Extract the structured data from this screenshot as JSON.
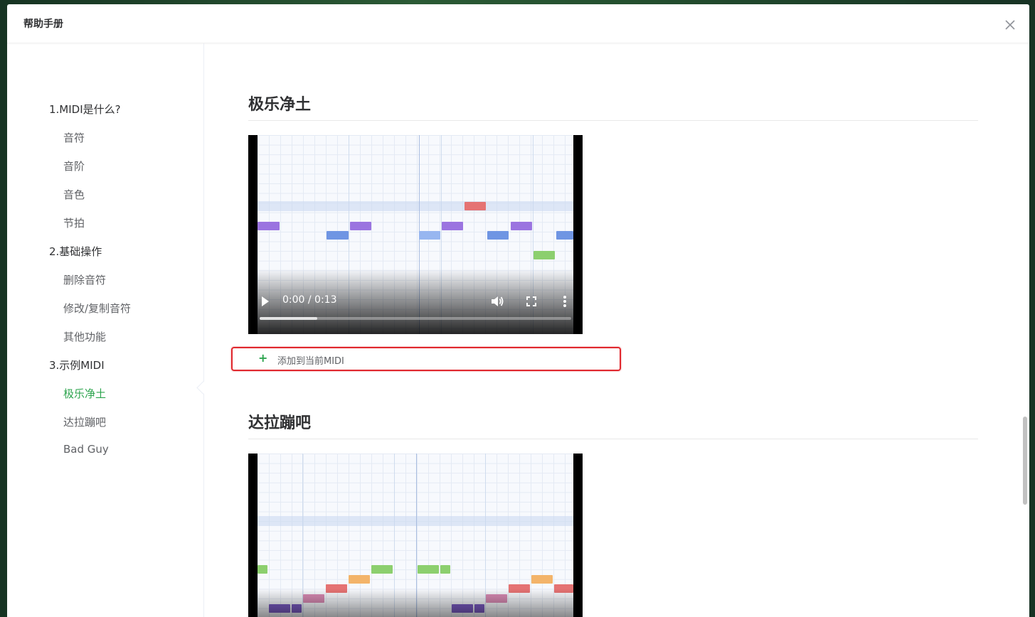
{
  "dialog": {
    "title": "帮助手册",
    "close_icon": "close-icon"
  },
  "toc": {
    "items": [
      {
        "label": "1.MIDI是什么?",
        "level": 1
      },
      {
        "label": "音符",
        "level": 2
      },
      {
        "label": "音阶",
        "level": 2
      },
      {
        "label": "音色",
        "level": 2
      },
      {
        "label": "节拍",
        "level": 2
      },
      {
        "label": "2.基础操作",
        "level": 1
      },
      {
        "label": "删除音符",
        "level": 2
      },
      {
        "label": "修改/复制音符",
        "level": 2
      },
      {
        "label": "其他功能",
        "level": 2
      },
      {
        "label": "3.示例MIDI",
        "level": 1
      },
      {
        "label": "极乐净土",
        "level": 2,
        "active": true
      },
      {
        "label": "达拉蹦吧",
        "level": 2
      },
      {
        "label": "Bad Guy",
        "level": 2
      }
    ],
    "active_color": "#2da44e"
  },
  "sections": [
    {
      "title": "极乐净土",
      "video": {
        "time": "0:00 / 0:13",
        "buffered_fraction": 0.18,
        "icons": [
          "play-icon",
          "volume-icon",
          "fullscreen-icon",
          "more-options-icon"
        ]
      },
      "add_button": {
        "icon": "plus-icon",
        "label": "添加到当前MIDI"
      }
    },
    {
      "title": "达拉蹦吧"
    }
  ],
  "colors": {
    "note_purple": "#9b74e0",
    "note_blue": "#6f95e3",
    "note_light_blue": "#97b6f0",
    "note_red": "#e57373",
    "note_green": "#8ccf6e",
    "note_orange": "#f3b46a",
    "note_pink": "#d98bb4",
    "note_deep_purple": "#7c5cc4",
    "highlight_border": "#e0282e"
  }
}
